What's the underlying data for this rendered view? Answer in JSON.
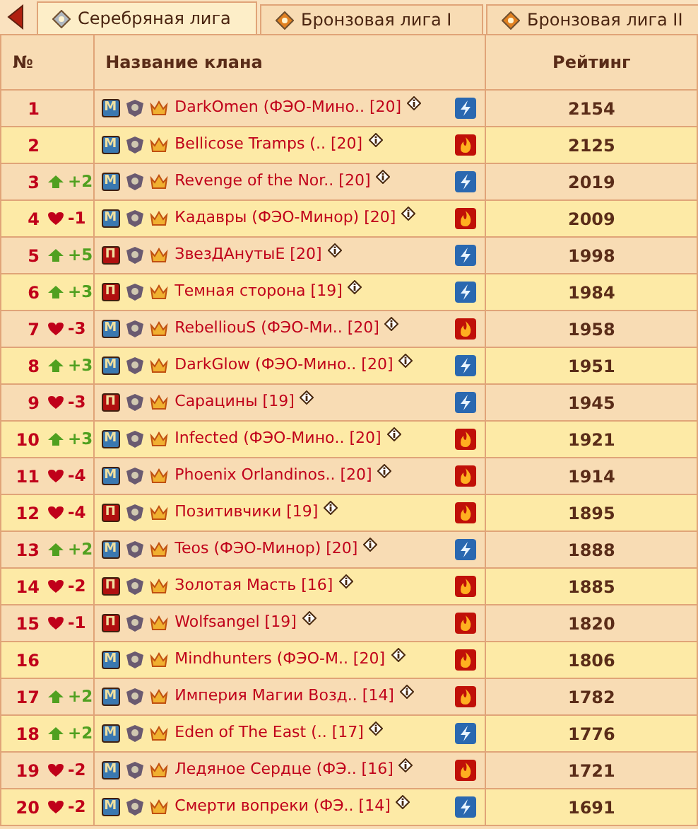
{
  "tabs": [
    {
      "label": "Серебряная лига",
      "selected": true
    },
    {
      "label": "Бронзовая лига I",
      "selected": false
    },
    {
      "label": "Бронзовая лига II",
      "selected": false
    }
  ],
  "table": {
    "columns": [
      "№",
      "Название клана",
      "Рейтинг"
    ],
    "rows": [
      {
        "rank": "1",
        "faction": "М",
        "color": "#3a78b0",
        "name": "DarkOmen (ФЭО-Мино..",
        "level": "[20]",
        "kind": "lightning",
        "rating": "2154"
      },
      {
        "rank": "2",
        "faction": "М",
        "color": "#3a78b0",
        "name": "Bellicose Tramps (..",
        "level": "[20]",
        "kind": "fire",
        "rating": "2125"
      },
      {
        "rank": "3",
        "rising": true,
        "change": "+2",
        "faction": "М",
        "color": "#3a78b0",
        "name": "Revenge of the Nor..",
        "level": "[20]",
        "kind": "lightning",
        "rating": "2019"
      },
      {
        "rank": "4",
        "rising": false,
        "change": "-1",
        "faction": "М",
        "color": "#3a78b0",
        "name": "Кадавры (ФЭО-Минор)",
        "level": "[20]",
        "kind": "fire",
        "rating": "2009"
      },
      {
        "rank": "5",
        "rising": true,
        "change": "+5",
        "faction": "П",
        "color": "#b01010",
        "name": "ЗвезДАнутыЕ",
        "level": "[20]",
        "kind": "lightning",
        "rating": "1998"
      },
      {
        "rank": "6",
        "rising": true,
        "change": "+3",
        "faction": "П",
        "color": "#b01010",
        "name": "Темная сторона",
        "level": "[19]",
        "kind": "lightning",
        "rating": "1984"
      },
      {
        "rank": "7",
        "rising": false,
        "change": "-3",
        "faction": "М",
        "color": "#3a78b0",
        "name": "RebelliouS (ФЭО-Ми..",
        "level": "[20]",
        "kind": "fire",
        "rating": "1958"
      },
      {
        "rank": "8",
        "rising": true,
        "change": "+3",
        "faction": "М",
        "color": "#3a78b0",
        "name": "DarkGlow (ФЭО-Мино..",
        "level": "[20]",
        "kind": "lightning",
        "rating": "1951"
      },
      {
        "rank": "9",
        "rising": false,
        "change": "-3",
        "faction": "П",
        "color": "#b01010",
        "name": "Сарацины",
        "level": "[19]",
        "kind": "lightning",
        "rating": "1945"
      },
      {
        "rank": "10",
        "rising": true,
        "change": "+3",
        "faction": "М",
        "color": "#3a78b0",
        "name": "Infected (ФЭО-Мино..",
        "level": "[20]",
        "kind": "fire",
        "rating": "1921"
      },
      {
        "rank": "11",
        "rising": false,
        "change": "-4",
        "faction": "М",
        "color": "#3a78b0",
        "name": "Phoenix Orlandinos..",
        "level": "[20]",
        "kind": "fire",
        "rating": "1914"
      },
      {
        "rank": "12",
        "rising": false,
        "change": "-4",
        "faction": "П",
        "color": "#b01010",
        "name": "Позитивчики",
        "level": "[19]",
        "kind": "fire",
        "rating": "1895"
      },
      {
        "rank": "13",
        "rising": true,
        "change": "+2",
        "faction": "М",
        "color": "#3a78b0",
        "name": "Teos (ФЭО-Минор)",
        "level": "[20]",
        "kind": "lightning",
        "rating": "1888"
      },
      {
        "rank": "14",
        "rising": false,
        "change": "-2",
        "faction": "П",
        "color": "#b01010",
        "name": "Золотая Масть",
        "level": "[16]",
        "kind": "fire",
        "rating": "1885"
      },
      {
        "rank": "15",
        "rising": false,
        "change": "-1",
        "faction": "П",
        "color": "#b01010",
        "name": "Wolfsangel",
        "level": "[19]",
        "kind": "fire",
        "rating": "1820"
      },
      {
        "rank": "16",
        "faction": "М",
        "color": "#3a78b0",
        "name": "Mindhunters (ФЭО-М..",
        "level": "[20]",
        "kind": "fire",
        "rating": "1806"
      },
      {
        "rank": "17",
        "rising": true,
        "change": "+2",
        "faction": "М",
        "color": "#3a78b0",
        "name": "Империя Магии Возд..",
        "level": "[14]",
        "kind": "fire",
        "rating": "1782"
      },
      {
        "rank": "18",
        "rising": true,
        "change": "+2",
        "faction": "М",
        "color": "#3a78b0",
        "name": "Eden of The East (..",
        "level": "[17]",
        "kind": "lightning",
        "rating": "1776"
      },
      {
        "rank": "19",
        "rising": false,
        "change": "-2",
        "faction": "М",
        "color": "#3a78b0",
        "name": "Ледяное Сердце (ФЭ..",
        "level": "[16]",
        "kind": "fire",
        "rating": "1721"
      },
      {
        "rank": "20",
        "rising": false,
        "change": "-2",
        "faction": "М",
        "color": "#3a78b0",
        "name": "Смерти вопреки (ФЭ..",
        "level": "[14]",
        "kind": "lightning",
        "rating": "1691"
      }
    ]
  }
}
